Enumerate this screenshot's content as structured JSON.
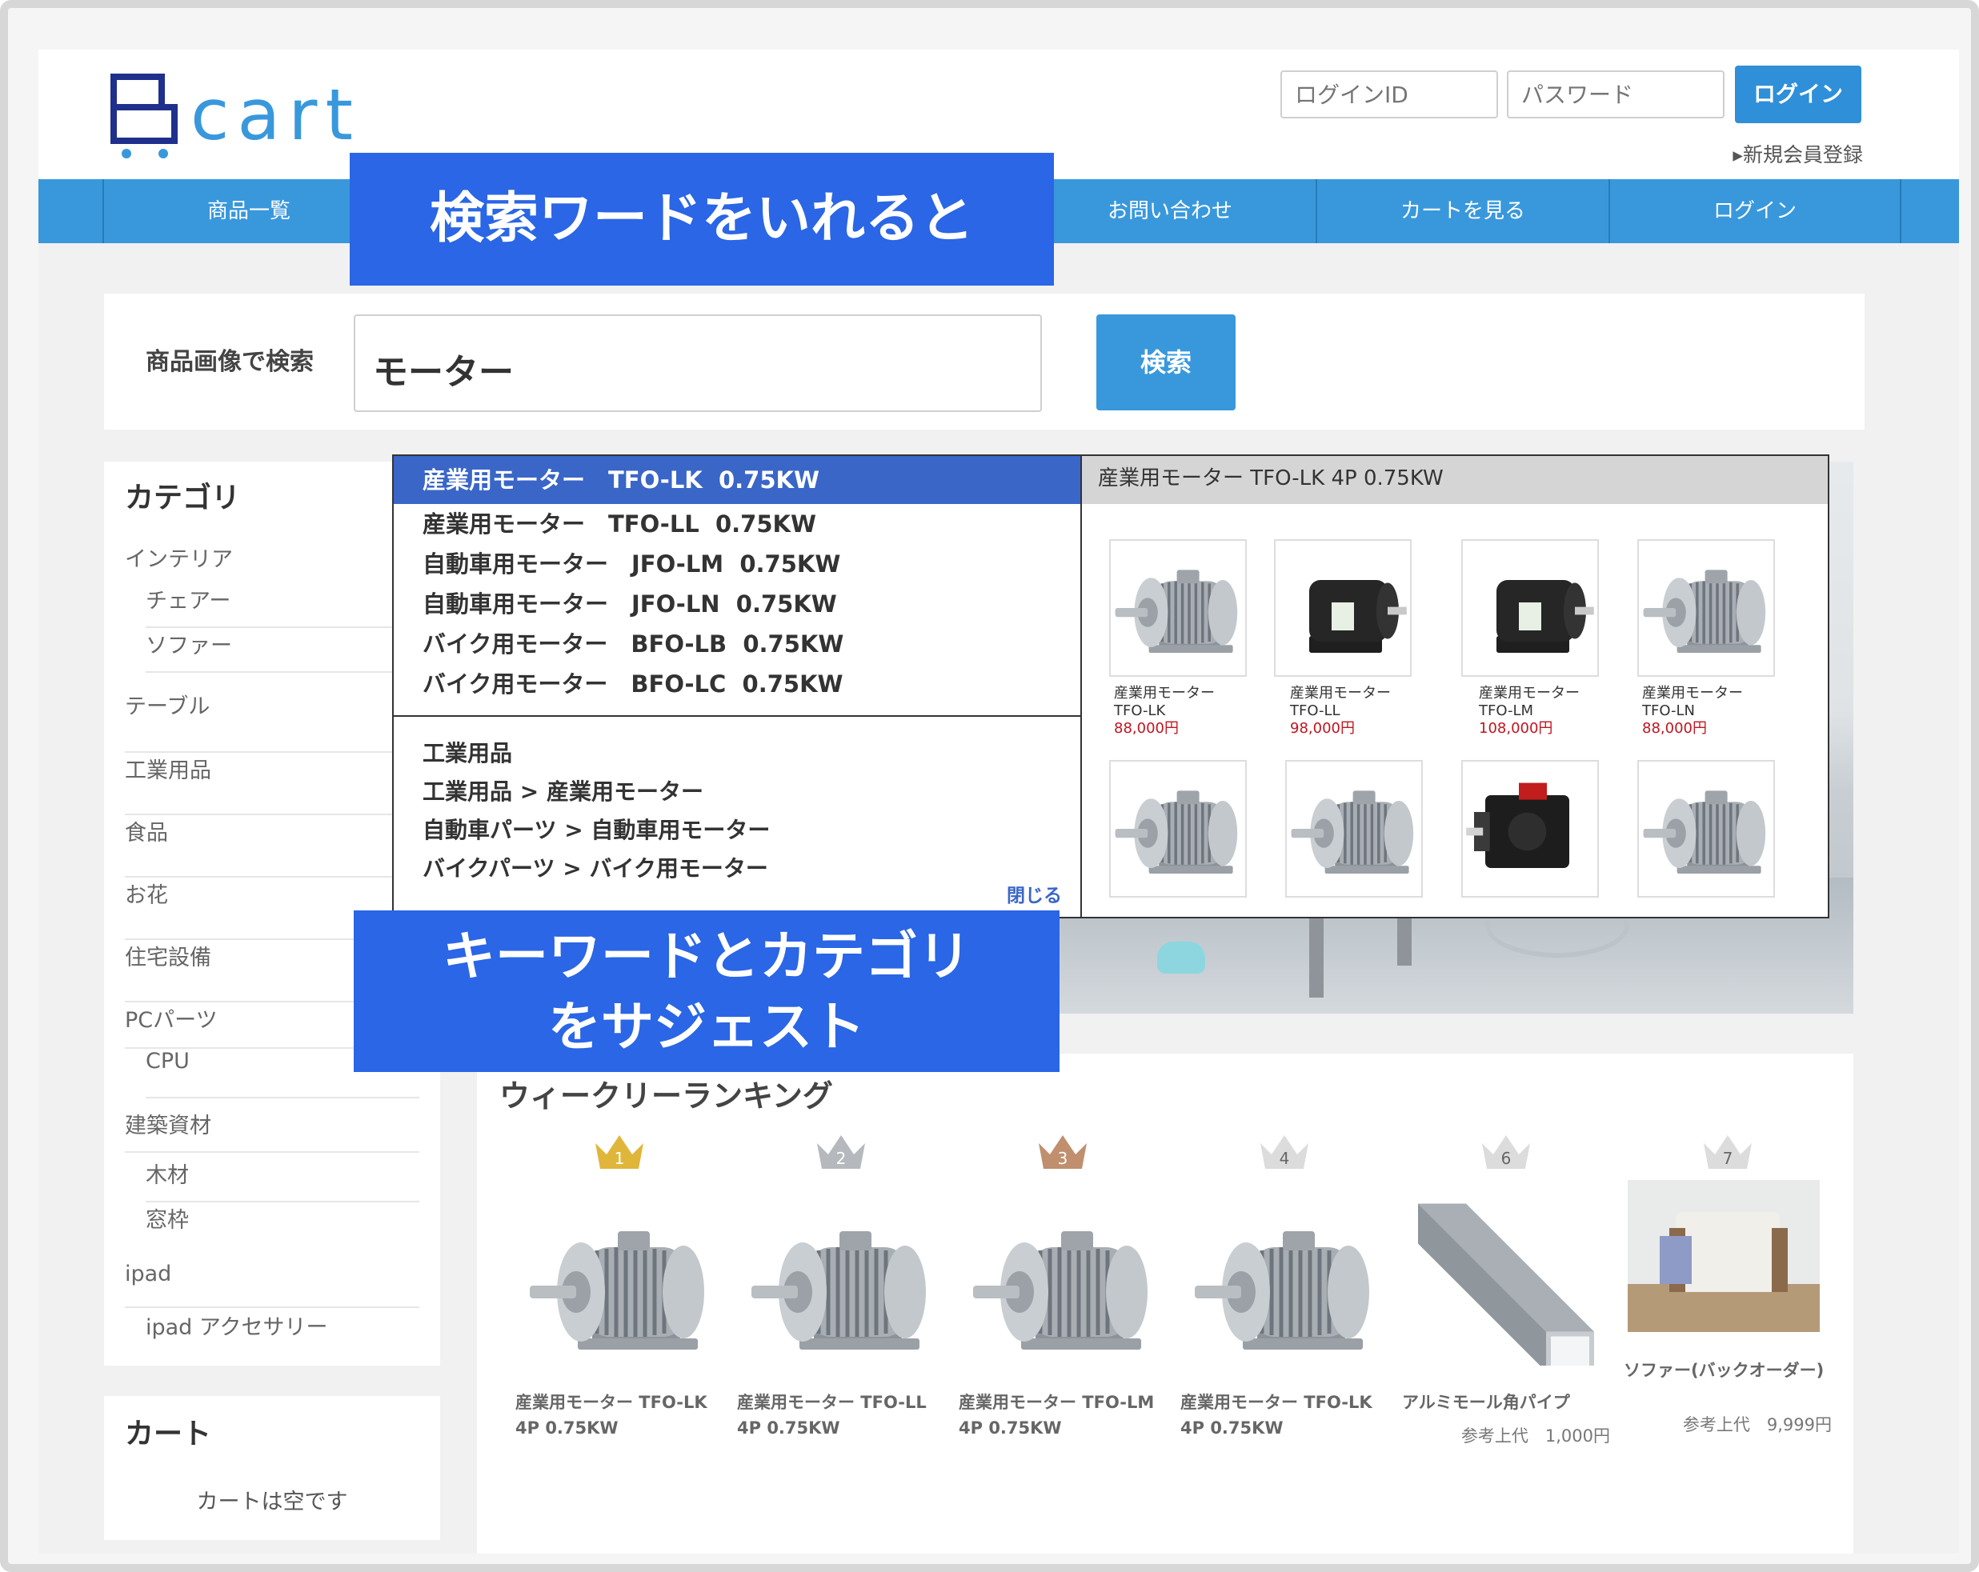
{
  "header": {
    "logo_text": "Bcart",
    "login_id_placeholder": "ログインID",
    "password_placeholder": "パスワード",
    "login_button": "ログイン",
    "register_link": "新規会員登録",
    "accent_color": "#3998dc",
    "logo_color": "#1f2f8c"
  },
  "nav": {
    "items": [
      "商品一覧",
      "お問い合わせ",
      "カートを見る",
      "ログイン"
    ]
  },
  "search": {
    "label": "商品画像で検索",
    "value": "モーター",
    "button": "検索"
  },
  "suggest": {
    "keywords": [
      "産業用モーター　TFO-LK  0.75KW",
      "産業用モーター　TFO-LL  0.75KW",
      "自動車用モーター　JFO-LM  0.75KW",
      "自動車用モーター　JFO-LN  0.75KW",
      "バイク用モーター　BFO-LB  0.75KW",
      "バイク用モーター　BFO-LC  0.75KW"
    ],
    "categories": [
      "工業用品",
      "工業用品 > 産業用モーター",
      "自動車パーツ > 自動車用モーター",
      "バイクパーツ > バイク用モーター"
    ],
    "close": "閉じる",
    "preview_title": "産業用モーター TFO-LK 4P 0.75KW",
    "preview_products": [
      {
        "name": "産業用モーター",
        "code": "TFO-LK",
        "price": "88,000円"
      },
      {
        "name": "産業用モーター",
        "code": "TFO-LL",
        "price": "98,000円"
      },
      {
        "name": "産業用モーター",
        "code": "TFO-LM",
        "price": "108,000円"
      },
      {
        "name": "産業用モーター",
        "code": "TFO-LN",
        "price": "88,000円"
      }
    ],
    "selection_color": "#3a66c8"
  },
  "sidebar": {
    "category_title": "カテゴリ",
    "categories": [
      {
        "label": "インテリア",
        "sub": false
      },
      {
        "label": "チェアー",
        "sub": true
      },
      {
        "label": "ソファー",
        "sub": true
      },
      {
        "label": "テーブル",
        "sub": false
      },
      {
        "label": "工業用品",
        "sub": false
      },
      {
        "label": "食品",
        "sub": false
      },
      {
        "label": "お花",
        "sub": false
      },
      {
        "label": "住宅設備",
        "sub": false
      },
      {
        "label": "PCパーツ",
        "sub": false
      },
      {
        "label": "CPU",
        "sub": true
      },
      {
        "label": "建築資材",
        "sub": false
      },
      {
        "label": "木材",
        "sub": true
      },
      {
        "label": "窓枠",
        "sub": true
      },
      {
        "label": "ipad",
        "sub": false
      },
      {
        "label": "ipad アクセサリー",
        "sub": true
      }
    ],
    "cart_title": "カート",
    "cart_empty": "カートは空です"
  },
  "ranking": {
    "title": "ウィークリーランキング",
    "items": [
      {
        "rank": "1",
        "name": "産業用モーター TFO-LK 4P 0.75KW",
        "price": "",
        "crown_color": "#e0b63a"
      },
      {
        "rank": "2",
        "name": "産業用モーター TFO-LL 4P 0.75KW",
        "price": "",
        "crown_color": "#b5b9bd"
      },
      {
        "rank": "3",
        "name": "産業用モーター TFO-LM 4P 0.75KW",
        "price": "",
        "crown_color": "#c08f6e"
      },
      {
        "rank": "4",
        "name": "産業用モーター TFO-LK 4P 0.75KW",
        "price": "",
        "crown_color": "#dcdcdc"
      },
      {
        "rank": "6",
        "name": "アルミモール角パイプ",
        "price": "参考上代　1,000円",
        "crown_color": "#dcdcdc"
      },
      {
        "rank": "7",
        "name": "ソファー(バックオーダー)",
        "price": "参考上代　9,999円",
        "crown_color": "#dcdcdc"
      }
    ]
  },
  "callouts": {
    "top": "検索ワードをいれると",
    "bottom_line1": "キーワードとカテゴリ",
    "bottom_line2": "をサジェスト",
    "color": "#2a66e5"
  }
}
